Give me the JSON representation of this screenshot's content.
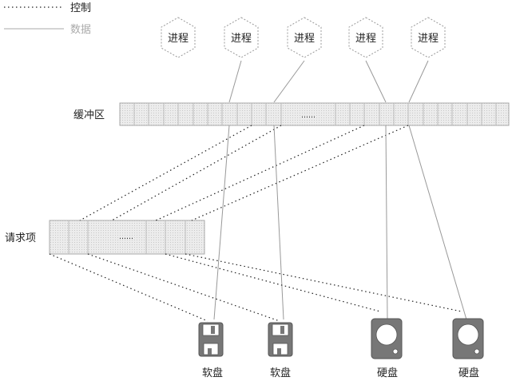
{
  "legend": {
    "control_label": "控制",
    "data_label": "数据"
  },
  "processes": [
    "进程",
    "进程",
    "进程",
    "进程",
    "进程"
  ],
  "buffer": {
    "label": "缓冲区",
    "ellipsis": "……"
  },
  "request": {
    "label": "请求项",
    "ellipsis": "……"
  },
  "devices": [
    "软盘",
    "软盘",
    "硬盘",
    "硬盘"
  ],
  "colors": {
    "line": "#888888",
    "dotted": "#222222",
    "cell": "#e6e6e6",
    "device": "#777777"
  }
}
